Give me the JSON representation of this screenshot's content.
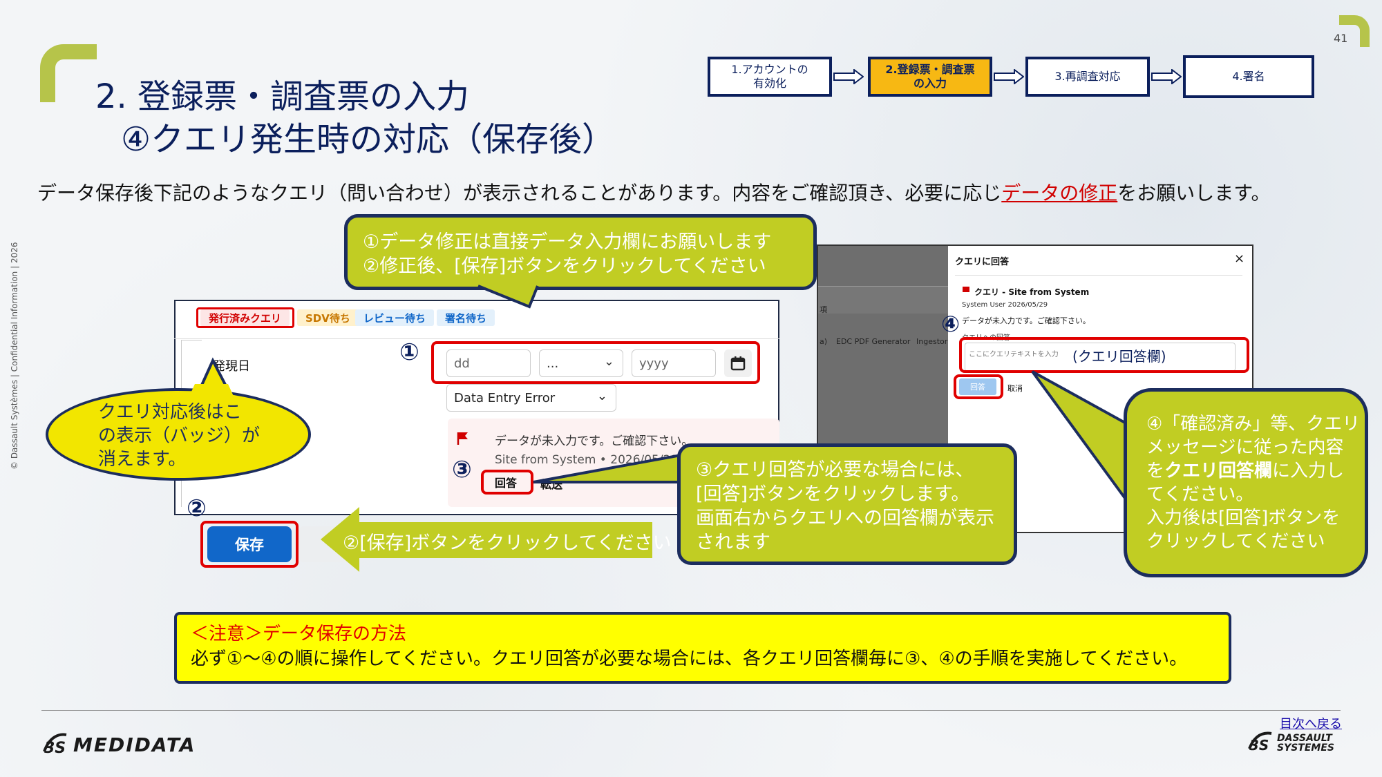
{
  "page_number": "41",
  "title_line1": "2. 登録票・調査票の入力",
  "title_line2": "④クエリ発生時の対応（保存後）",
  "side_note": "© Dassault Systèmes | Confidential Information | 2026",
  "steps": [
    {
      "line1": "1.アカウントの",
      "line2": "有効化"
    },
    {
      "line1": "2.登録票・調査票",
      "line2": "の入力"
    },
    {
      "line1": "3.再調査対応",
      "line2": ""
    },
    {
      "line1": "4.署名",
      "line2": ""
    }
  ],
  "intro": {
    "before": "データ保存後下記のようなクエリ（問い合わせ）が表示されることがあります。内容をご確認頂き、必要に応じ",
    "highlight": "データの修正",
    "after": "をお願いします。"
  },
  "top_callout": {
    "line1": "①データ修正は直接データ入力欄にお願いします",
    "line2": "②修正後、[保存]ボタンをクリックしてください"
  },
  "badges": [
    "発行済みクエリ",
    "SDV待ち",
    "レビュー待ち",
    "署名待ち"
  ],
  "field_label": "発現日",
  "date_fields": {
    "dd": "dd",
    "mm": "...",
    "yyyy": "yyyy"
  },
  "error_select": "Data Entry Error",
  "query": {
    "message": "データが未入力です。ご確認下さい。",
    "source": "Site from System",
    "date": "2026/05/29",
    "reply_label": "回答",
    "forward_label": "転送"
  },
  "numbers": {
    "n1": "①",
    "n2": "②",
    "n3": "③",
    "n4": "④"
  },
  "save_label": "保存",
  "yellow_callout": {
    "line1": "クエリ対応後はこ",
    "line2": "の表示（バッジ）が",
    "line3": "消えます。"
  },
  "save_callout": "②[保存]ボタンをクリックしてください",
  "callout3": {
    "line1": "③クエリ回答が必要な場合には、",
    "line2": "[回答]ボタンをクリックします。",
    "line3": "画面右からクエリへの回答欄が表示",
    "line4": "されます"
  },
  "right_panel": {
    "title": "クエリに回答",
    "close": "×",
    "query_title": "クエリ - Site from System",
    "user": "System User",
    "date": "2026/05/29",
    "message": "データが未入力です。ご確認下さい。",
    "reply_section": "クエリへの回答",
    "input_placeholder": "ここにクエリテキストを入力",
    "input_annotation": "(クエリ回答欄)",
    "reply_btn": "回答",
    "cancel": "取消",
    "bg_texts": [
      "EDC PDF Generator",
      "Ingestor",
      "a)",
      "項"
    ]
  },
  "callout4": {
    "line1": "④「確認済み」等、クエリ",
    "line2": "メッセージに従った内容",
    "line3a": "を",
    "line3b": "クエリ回答欄",
    "line3c": "に入力し",
    "line4": "てください。",
    "line5": "入力後は[回答]ボタンを",
    "line6": "クリックしてください"
  },
  "note": {
    "title": "＜注意＞データ保存の方法",
    "body": "必ず①～④の順に操作してください。クエリ回答が必要な場合には、各クエリ回答欄毎に③、④の手順を実施してください。"
  },
  "footer": {
    "back_link": "目次へ戻る",
    "medidata": "MEDIDATA",
    "dassault_line1": "DASSAULT",
    "dassault_line2": "SYSTEMES"
  },
  "colors": {
    "accent_green": "#c1cd23",
    "navy": "#1c2d5e",
    "highlight_red": "#e00000",
    "step_active": "#f7b813",
    "save_blue": "#1167c9"
  }
}
